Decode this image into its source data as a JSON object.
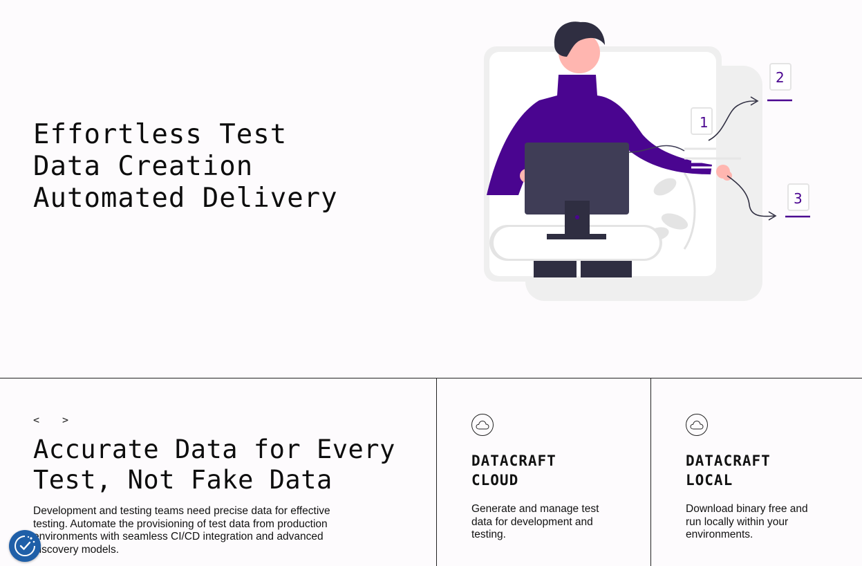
{
  "hero": {
    "title_lines": [
      "Effortless Test",
      "Data Creation",
      "Automated Delivery"
    ],
    "illustration": {
      "step_labels": [
        "1",
        "2",
        "3"
      ],
      "accent_color": "#4a0590",
      "icon": "developer-presenting-illustration"
    }
  },
  "feature": {
    "icon": "code-brackets-icon",
    "icon_text": "< >",
    "title_lines": [
      "Accurate Data for Every",
      "Test, Not Fake Data"
    ],
    "description": "Development and testing teams need precise data for effective testing. Automate the provisioning of test data from production environments with seamless CI/CD integration and advanced discovery models."
  },
  "products": [
    {
      "icon": "cloud-icon",
      "name_lines": [
        "DATACRAFT",
        "CLOUD"
      ],
      "description": "Generate and manage test data for development and testing."
    },
    {
      "icon": "cloud-icon",
      "name_lines": [
        "DATACRAFT",
        "LOCAL"
      ],
      "description": "Download binary free and run locally within your environments."
    }
  ],
  "cookie_button": {
    "icon": "cookie-consent-icon",
    "color": "#1f5fa8"
  }
}
